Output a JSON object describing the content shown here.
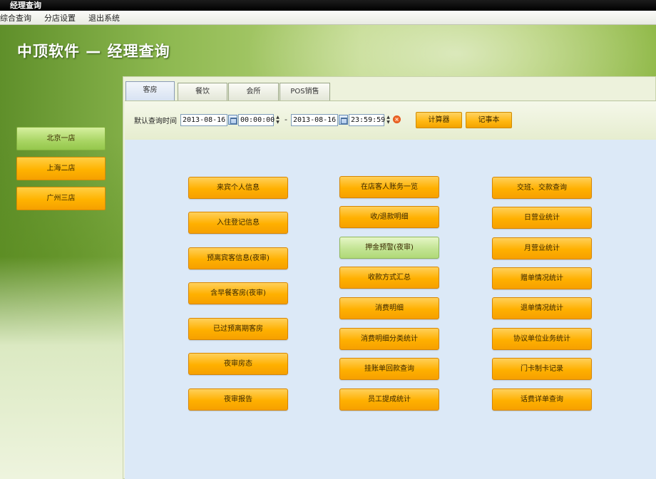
{
  "window": {
    "title": "经理查询"
  },
  "menu": [
    "综合查询",
    "分店设置",
    "退出系统"
  ],
  "app_title": "中顶软件 — 经理查询",
  "stores": [
    {
      "label": "北京一店",
      "selected": true
    },
    {
      "label": "上海二店",
      "selected": false
    },
    {
      "label": "广州三店",
      "selected": false
    }
  ],
  "tabs": [
    "客房",
    "餐饮",
    "会所",
    "POS销售"
  ],
  "toolbar": {
    "query_time_label": "默认查询时间",
    "start_date": "2013-08-16",
    "start_time": "00:00:00",
    "separator": "-",
    "end_date": "2013-08-16",
    "end_time": "23:59:59",
    "calculator_label": "计算器",
    "notepad_label": "记事本"
  },
  "functions": {
    "col1": [
      "来宾个人信息",
      "入住登记信息",
      "预离宾客信息(夜审)",
      "含早餐客房(夜审)",
      "已过预离期客房",
      "夜审房态",
      "夜审报告"
    ],
    "col2": [
      "在店客人账务一览",
      "收/退款明细",
      "押金预警(夜审)",
      "收款方式汇总",
      "消费明细",
      "消费明细分类统计",
      "挂账单回款查询",
      "员工提成统计"
    ],
    "col3": [
      "交班、交款查询",
      "日营业统计",
      "月营业统计",
      "赠单情况统计",
      "退单情况统计",
      "协议单位业务统计",
      "门卡制卡记录",
      "话费详单查询"
    ]
  },
  "colors": {
    "accent_orange": "#ffb000",
    "accent_green": "#b0d978",
    "content_bg": "#dce9f7"
  }
}
